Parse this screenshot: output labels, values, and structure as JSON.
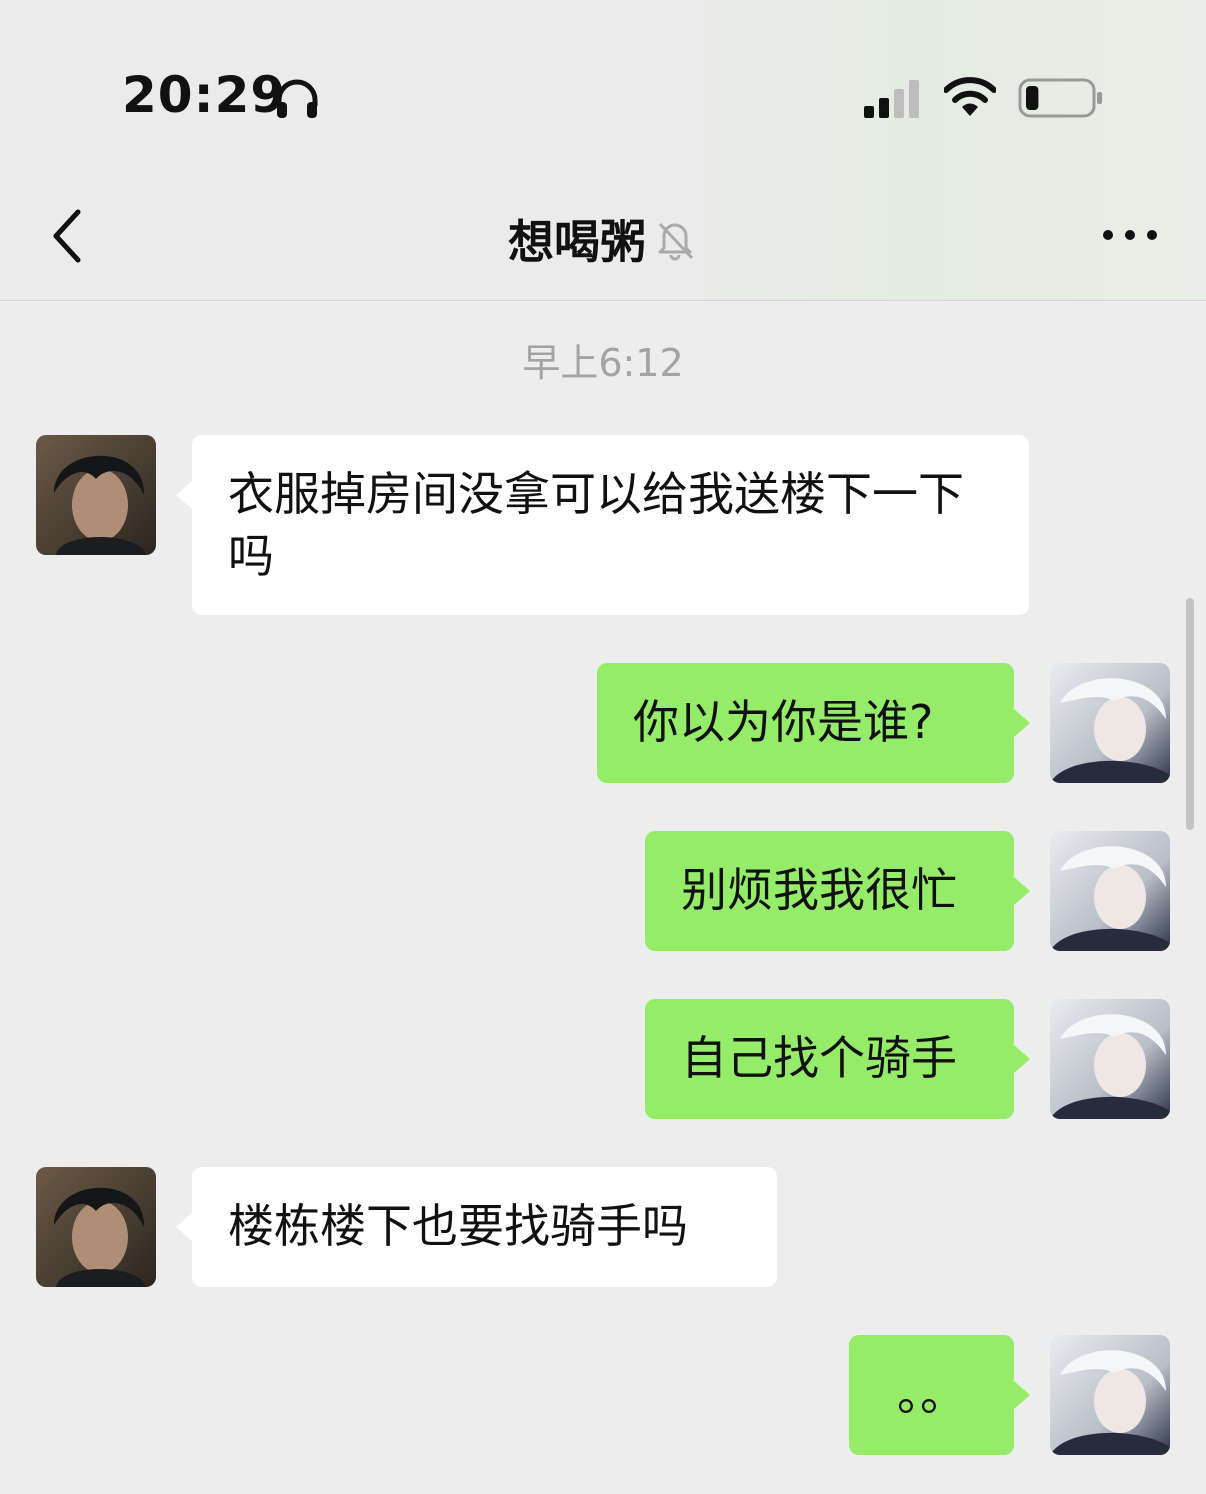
{
  "status_bar": {
    "time": "20:29",
    "battery_level": 0.2
  },
  "header": {
    "title": "想喝粥"
  },
  "chat": {
    "timestamp": "早上6:12",
    "messages": [
      {
        "side": "in",
        "text": "衣服掉房间没拿可以给我送楼下一下吗"
      },
      {
        "side": "out",
        "text": "你以为你是谁?"
      },
      {
        "side": "out",
        "text": "别烦我我很忙"
      },
      {
        "side": "out",
        "text": "自己找个骑手"
      },
      {
        "side": "in",
        "text": "楼栋楼下也要找骑手吗"
      },
      {
        "side": "out",
        "text": "。。"
      }
    ]
  },
  "colors": {
    "outgoing_bubble": "#95ec69",
    "incoming_bubble": "#ffffff",
    "background": "#ededed"
  }
}
